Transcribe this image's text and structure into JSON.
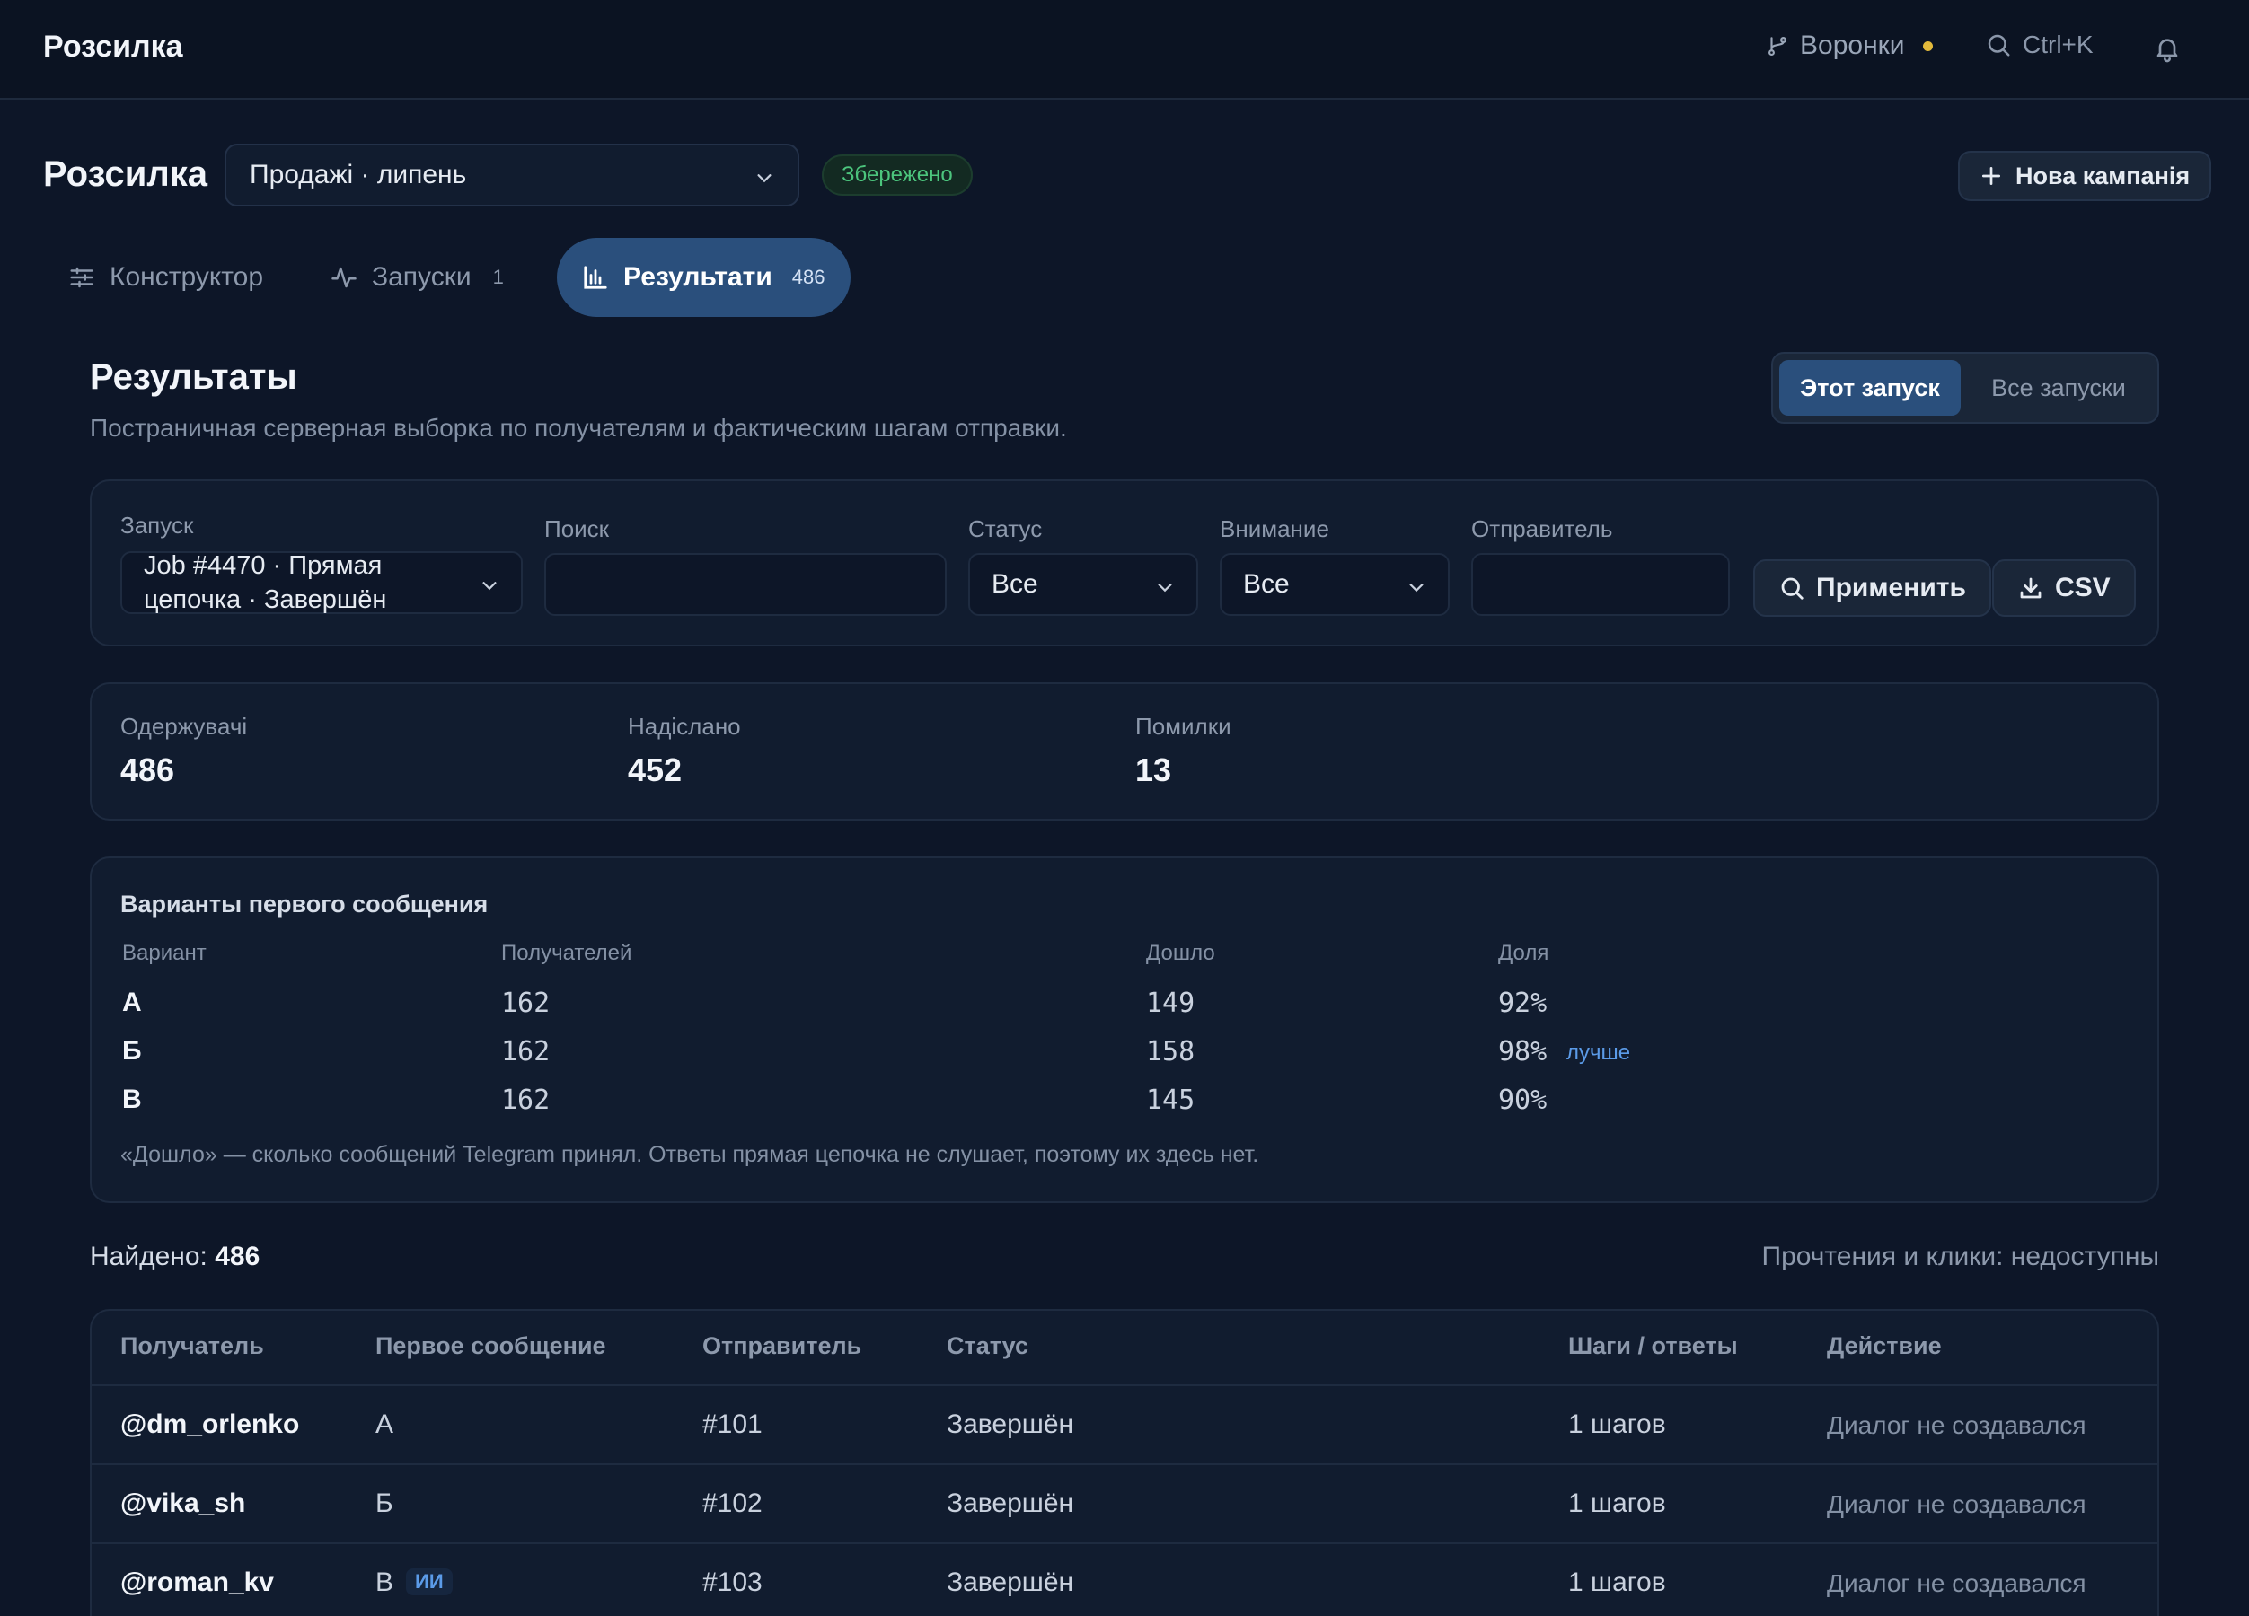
{
  "topbar": {
    "brand": "Розсилка",
    "funnels_label": "Воронки",
    "search_shortcut": "Ctrl+K"
  },
  "header": {
    "title": "Розсилка",
    "campaign_selected": "Продажі · липень",
    "saved_badge": "Збережено",
    "new_campaign_label": "Нова кампанія"
  },
  "tabs": [
    {
      "label": "Конструктор"
    },
    {
      "label": "Запуски",
      "count": "1"
    },
    {
      "label": "Результати",
      "count": "486"
    }
  ],
  "results": {
    "title": "Результаты",
    "subtitle": "Постраничная серверная выборка по получателям и фактическим шагам отправки.",
    "scope_this": "Этот запуск",
    "scope_all": "Все запуски"
  },
  "filters": {
    "launch_label": "Запуск",
    "launch_value_line1": "Job #4470 · Прямая",
    "launch_value_line2": "цепочка · Завершён",
    "search_label": "Поиск",
    "search_value": "",
    "status_label": "Статус",
    "status_value": "Все",
    "attention_label": "Внимание",
    "attention_value": "Все",
    "sender_label": "Отправитель",
    "sender_value": "",
    "apply_label": "Применить",
    "csv_label": "CSV"
  },
  "stats": [
    {
      "label": "Одержувачі",
      "value": "486"
    },
    {
      "label": "Надіслано",
      "value": "452"
    },
    {
      "label": "Помилки",
      "value": "13"
    }
  ],
  "variants": {
    "title": "Варианты первого сообщения",
    "headers": [
      "Вариант",
      "Получателей",
      "Дошло",
      "Доля"
    ],
    "rows": [
      {
        "name": "А",
        "recipients": "162",
        "delivered": "149",
        "share": "92%"
      },
      {
        "name": "Б",
        "recipients": "162",
        "delivered": "158",
        "share": "98%",
        "tag": "лучше"
      },
      {
        "name": "В",
        "recipients": "162",
        "delivered": "145",
        "share": "90%"
      }
    ],
    "note": "«Дошло» — сколько сообщений Telegram принял. Ответы прямая цепочка не слушает, поэтому их здесь нет."
  },
  "found": {
    "label": "Найдено:",
    "count": "486",
    "note": "Прочтения и клики: недоступны"
  },
  "table": {
    "headers": [
      "Получатель",
      "Первое сообщение",
      "Отправитель",
      "Статус",
      "Шаги / ответы",
      "Действие"
    ],
    "rows": [
      {
        "recipient": "@dm_orlenko",
        "first_message": "А",
        "sender": "#101",
        "status": "Завершён",
        "steps": "1 шагов",
        "action": "Диалог не создавался"
      },
      {
        "recipient": "@vika_sh",
        "first_message": "Б",
        "sender": "#102",
        "status": "Завершён",
        "steps": "1 шагов",
        "action": "Диалог не создавался"
      },
      {
        "recipient": "@roman_kv",
        "first_message": "В",
        "ai_badge": "ИИ",
        "sender": "#103",
        "status": "Завершён",
        "steps": "1 шагов",
        "action": "Диалог не создавался"
      }
    ]
  }
}
